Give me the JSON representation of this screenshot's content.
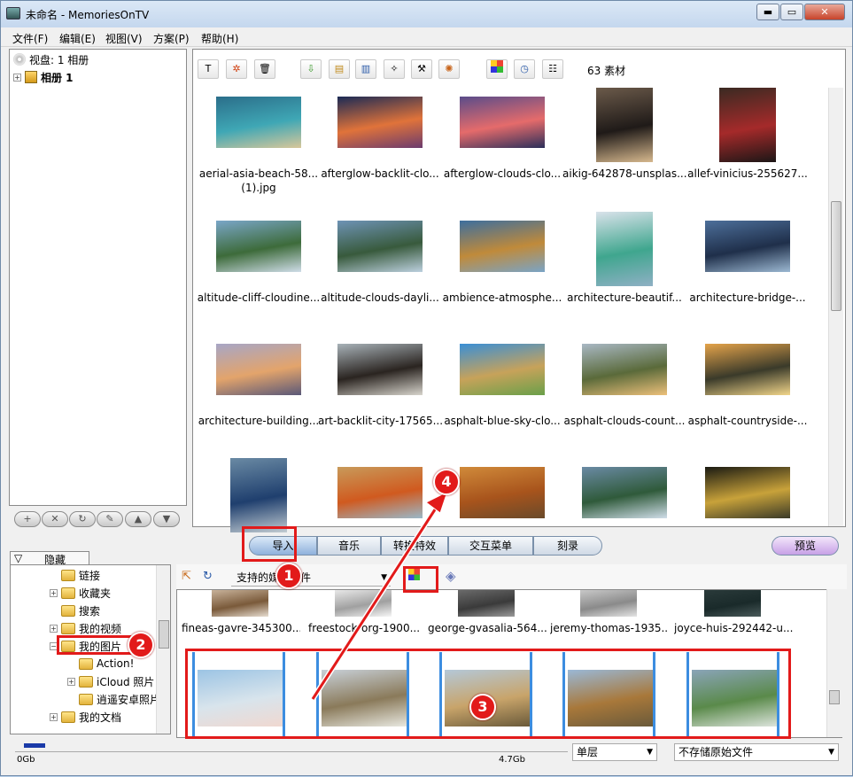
{
  "window": {
    "title": "未命名 - MemoriesOnTV",
    "min_label": "▬",
    "max_label": "▭",
    "close_label": "✕"
  },
  "menu": [
    "文件(F)",
    "编辑(E)",
    "视图(V)",
    "方案(P)",
    "帮助(H)"
  ],
  "disc_tree": {
    "disc_label": "视盘: 1 相册",
    "album_label": "相册 1"
  },
  "left_buttons": [
    "+",
    "✕",
    "↻",
    "✎",
    "▲",
    "▼"
  ],
  "toolbar": {
    "count_label": "63 素材"
  },
  "thumbnails": [
    {
      "caption": "aerial-asia-beach-58...",
      "caption2": "(1).jpg",
      "colors": [
        "#2b6e8a",
        "#3fa7b5",
        "#d8c79a"
      ]
    },
    {
      "caption": "afterglow-backlit-clo...",
      "colors": [
        "#1a2a55",
        "#e0733a",
        "#6b3b6e"
      ]
    },
    {
      "caption": "afterglow-clouds-clo...",
      "colors": [
        "#5a4c8a",
        "#e56b6b",
        "#2b2f5a"
      ]
    },
    {
      "caption": "aikig-642878-unsplas...",
      "colors": [
        "#6b5a4a",
        "#1f1a18",
        "#d6b88e"
      ]
    },
    {
      "caption": "allef-vinicius-255627...",
      "colors": [
        "#3a2a22",
        "#a52a2a",
        "#1c1616"
      ]
    },
    {
      "caption": "altitude-cliff-cloudine...",
      "colors": [
        "#7aa6c8",
        "#3d6b3a",
        "#cfdde8"
      ]
    },
    {
      "caption": "altitude-clouds-dayli...",
      "colors": [
        "#6e93b5",
        "#385a3c",
        "#bcd0de"
      ]
    },
    {
      "caption": "ambience-atmosphe...",
      "colors": [
        "#3d6e9e",
        "#c08a3a",
        "#7aa4c6"
      ]
    },
    {
      "caption": "architecture-beautif...",
      "colors": [
        "#d9e2ea",
        "#3fa68e",
        "#8fb0c4"
      ]
    },
    {
      "caption": "architecture-bridge-...",
      "colors": [
        "#4d6f9a",
        "#1f2f4a",
        "#9cb8d2"
      ]
    },
    {
      "caption": "architecture-building...",
      "colors": [
        "#a7a6c6",
        "#e3a46b",
        "#5a5878"
      ]
    },
    {
      "caption": "art-backlit-city-17565...",
      "colors": [
        "#a8b2b8",
        "#2a2420",
        "#d7d4cc"
      ]
    },
    {
      "caption": "asphalt-blue-sky-clo...",
      "colors": [
        "#3a8fd6",
        "#c7a25a",
        "#6aa04a"
      ]
    },
    {
      "caption": "asphalt-clouds-count...",
      "colors": [
        "#a9b8c4",
        "#5a6a3a",
        "#ecc07a"
      ]
    },
    {
      "caption": "asphalt-countryside-...",
      "colors": [
        "#e4a34a",
        "#3a3a2a",
        "#f1d58a"
      ]
    },
    {
      "caption": "",
      "colors": [
        "#6a8aa4",
        "#1f3f6e",
        "#c2ccd2"
      ]
    },
    {
      "caption": "",
      "colors": [
        "#c89a5a",
        "#d05a1f",
        "#9ab8c8"
      ]
    },
    {
      "caption": "",
      "colors": [
        "#d08a3a",
        "#a8541c",
        "#6a4a2a"
      ]
    },
    {
      "caption": "",
      "colors": [
        "#6a8aa4",
        "#2f5a3a",
        "#cfdde8"
      ]
    },
    {
      "caption": "",
      "colors": [
        "#1a1a12",
        "#c8a23a",
        "#3a3a28"
      ]
    }
  ],
  "tabs": {
    "import": "导入",
    "music": "音乐",
    "transition": "转换特效",
    "menu": "交互菜单",
    "burn": "刻录",
    "preview": "预览"
  },
  "hide_tab": "隐藏",
  "folder_tree": [
    "链接",
    "收藏夹",
    "搜索",
    "我的视频",
    "我的图片",
    "Action!",
    "iCloud 照片",
    "逍遥安卓照片",
    "我的文档"
  ],
  "filter": {
    "value": "支持的媒体文件"
  },
  "browser_files": [
    {
      "caption": "fineas-gavre-345300...",
      "colors": [
        "#c8b29a",
        "#7a5a3a",
        "#e6dcd0"
      ]
    },
    {
      "caption": "freestock-org-1900...",
      "colors": [
        "#e8e8e8",
        "#a0a0a0",
        "#f6f6f6"
      ]
    },
    {
      "caption": "george-gvasalia-564...",
      "colors": [
        "#6a6a6a",
        "#3a3a3a",
        "#9a9a9a"
      ]
    },
    {
      "caption": "jeremy-thomas-1935...",
      "colors": [
        "#c8c8c8",
        "#8a8a8a",
        "#e4e4e4"
      ]
    },
    {
      "caption": "joyce-huis-292442-u...",
      "colors": [
        "#2a3a3a",
        "#1a2a2a",
        "#4a5a5a"
      ]
    }
  ],
  "strip_thumbs": [
    {
      "colors": [
        "#9cc4e4",
        "#d8e4ec",
        "#f0d8d0"
      ]
    },
    {
      "colors": [
        "#c8d0d8",
        "#8a7a5a",
        "#e8e8e0"
      ]
    },
    {
      "colors": [
        "#b4c8d8",
        "#c8a46a",
        "#6a5a3a"
      ]
    },
    {
      "colors": [
        "#9ab8d6",
        "#a8783a",
        "#6a5a3a"
      ]
    },
    {
      "colors": [
        "#8aa4b8",
        "#5a8a4a",
        "#dce4dc"
      ]
    }
  ],
  "status": {
    "left_label": "0Gb",
    "mid_label": "4.7Gb",
    "layer_select": "单层",
    "store_select": "不存储原始文件"
  },
  "annotations": [
    "1",
    "2",
    "3",
    "4"
  ]
}
